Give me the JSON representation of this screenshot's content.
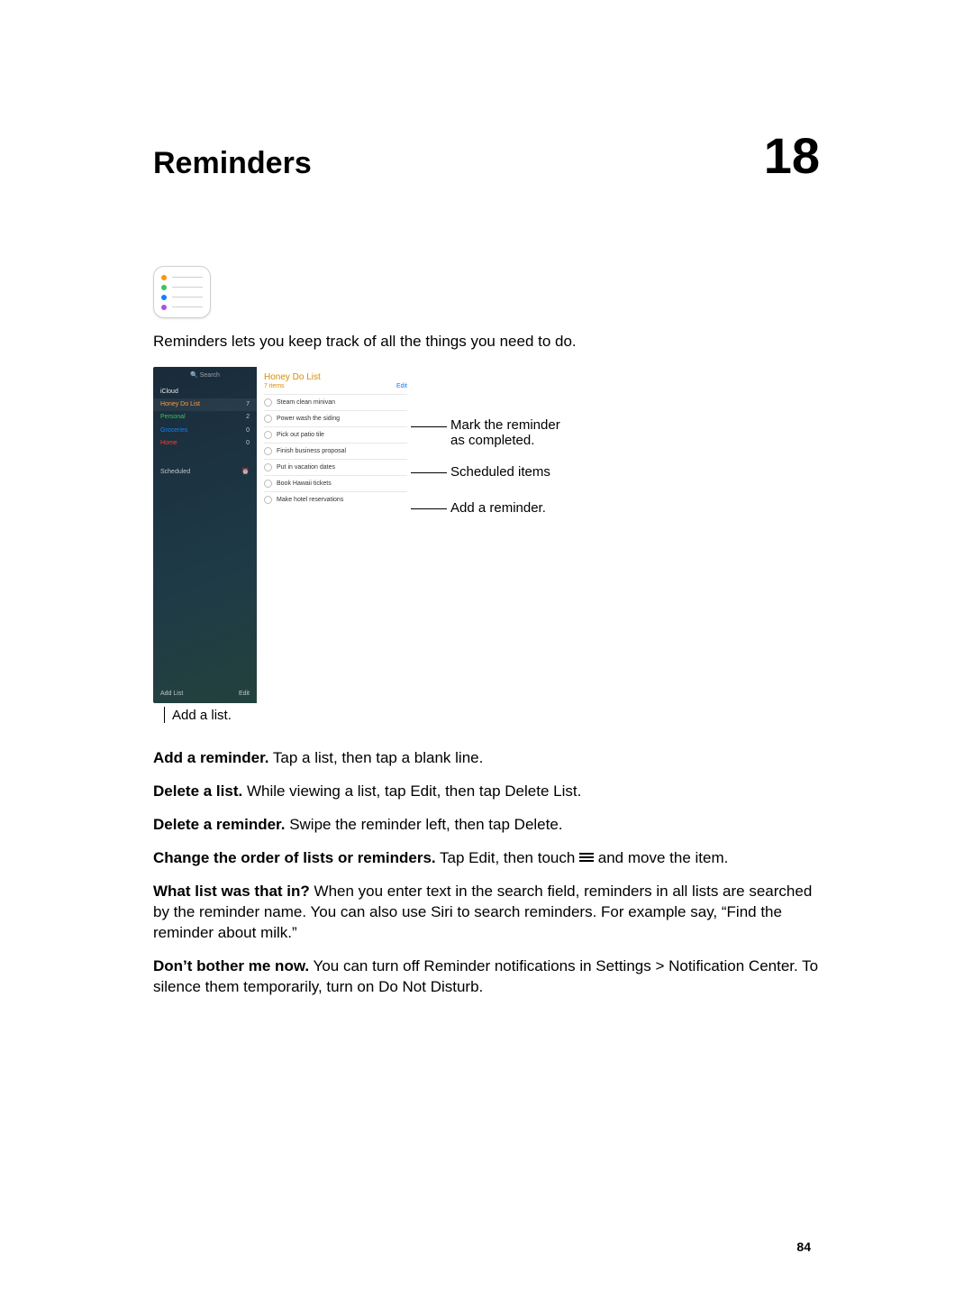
{
  "chapter": {
    "title": "Reminders",
    "number": "18"
  },
  "intro": "Reminders lets you keep track of all the things you need to do.",
  "app_icon_colors": [
    "#ff9500",
    "#34c759",
    "#0a84ff",
    "#af52de"
  ],
  "screenshot": {
    "search_placeholder": "Search",
    "account_label": "iCloud",
    "lists": [
      {
        "name": "Honey Do List",
        "count": "7",
        "color": "#ff6a00",
        "selected": true
      },
      {
        "name": "Personal",
        "count": "2",
        "color": "#34c759",
        "selected": false
      },
      {
        "name": "Groceries",
        "count": "0",
        "color": "#0a84ff",
        "selected": false
      },
      {
        "name": "Home",
        "count": "0",
        "color": "#ff3b30",
        "selected": false
      }
    ],
    "scheduled_label": "Scheduled",
    "add_list_label": "Add List",
    "sidebar_edit_label": "Edit",
    "pane": {
      "title": "Honey Do List",
      "items_label": "7 items",
      "edit_label": "Edit",
      "reminders": [
        "Steam clean minivan",
        "Power wash the siding",
        "Pick out patio tile",
        "Finish business proposal",
        "Put in vacation dates",
        "Book Hawaii tickets",
        "Make hotel reservations"
      ]
    }
  },
  "callouts": {
    "mark_completed_1": "Mark the reminder",
    "mark_completed_2": "as completed.",
    "scheduled": "Scheduled items",
    "add_reminder": "Add a reminder.",
    "add_list": "Add a list."
  },
  "body": {
    "p1_b": "Add a reminder.",
    "p1": " Tap a list, then tap a blank line.",
    "p2_b": "Delete a list.",
    "p2": " While viewing a list, tap Edit, then tap Delete List.",
    "p3_b": "Delete a reminder.",
    "p3": " Swipe the reminder left, then tap Delete.",
    "p4_b": "Change the order of lists or reminders.",
    "p4_a": " Tap Edit, then touch ",
    "p4_c": " and move the item.",
    "p5_b": "What list was that in?",
    "p5": " When you enter text in the search field, reminders in all lists are searched by the reminder name. You can also use Siri to search reminders. For example say, “Find the reminder about milk.”",
    "p6_b": "Don’t bother me now.",
    "p6": " You can turn off Reminder notifications in Settings > Notification Center. To silence them temporarily, turn on Do Not Disturb."
  },
  "page_number": "84"
}
